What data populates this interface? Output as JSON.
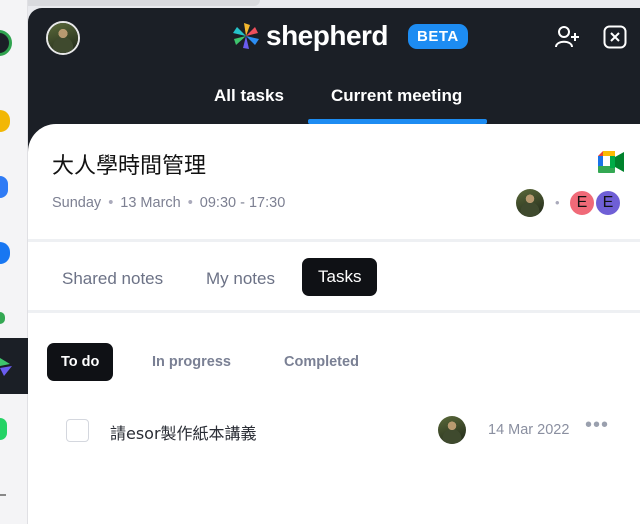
{
  "app": {
    "name": "shepherd",
    "badge": "BETA"
  },
  "header": {
    "add_user_icon": "person-plus-icon",
    "close_icon": "close-icon"
  },
  "main_tabs": [
    {
      "label": "All tasks"
    },
    {
      "label": "Current meeting",
      "active": true
    }
  ],
  "meeting": {
    "title": "大人學時間管理",
    "day": "Sunday",
    "date": "13 March",
    "time": "09:30 - 17:30",
    "attendees": [
      {
        "initial": "E",
        "color": "#f06a78"
      },
      {
        "initial": "E",
        "color": "#6f5fd6"
      }
    ]
  },
  "sub_tabs": [
    {
      "label": "Shared notes"
    },
    {
      "label": "My notes"
    },
    {
      "label": "Tasks",
      "active": true
    }
  ],
  "filters": [
    {
      "label": "To do",
      "active": true
    },
    {
      "label": "In progress"
    },
    {
      "label": "Completed"
    }
  ],
  "tasks": [
    {
      "text": "請esor製作紙本講義",
      "due": "14 Mar 2022",
      "done": false
    }
  ],
  "colors": {
    "accent": "#1d8cf2",
    "panel": "#1b1f26"
  }
}
